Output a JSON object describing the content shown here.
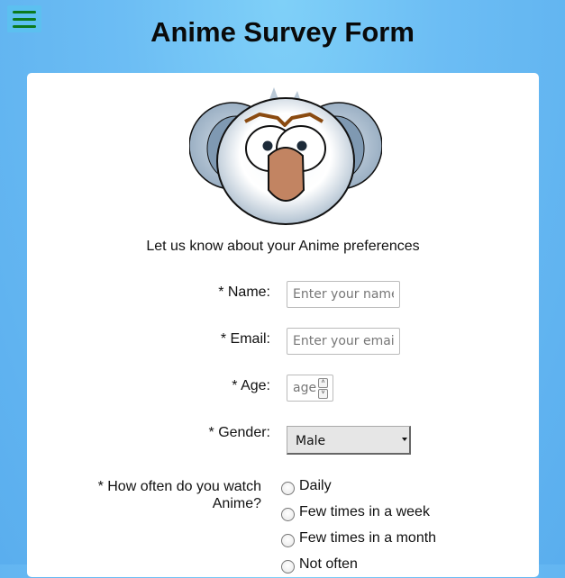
{
  "header": {
    "title": "Anime Survey Form"
  },
  "icons": {
    "menu": "hamburger-menu-icon",
    "logo": "koala-logo-icon"
  },
  "colors": {
    "background": "#6cbdf4",
    "menu_bars": "#0b7a1e",
    "card": "#ffffff"
  },
  "form": {
    "intro": "Let us know about your Anime preferences",
    "name": {
      "label": "* Name:",
      "placeholder": "Enter your name"
    },
    "email": {
      "label": "* Email:",
      "placeholder": "Enter your email"
    },
    "age": {
      "label": "* Age:",
      "placeholder": "age"
    },
    "gender": {
      "label": "* Gender:",
      "selected": "Male"
    },
    "frequency": {
      "label": "* How often do you watch Anime?",
      "options": [
        "Daily",
        "Few times in a week",
        "Few times in a month",
        "Not often"
      ]
    }
  }
}
